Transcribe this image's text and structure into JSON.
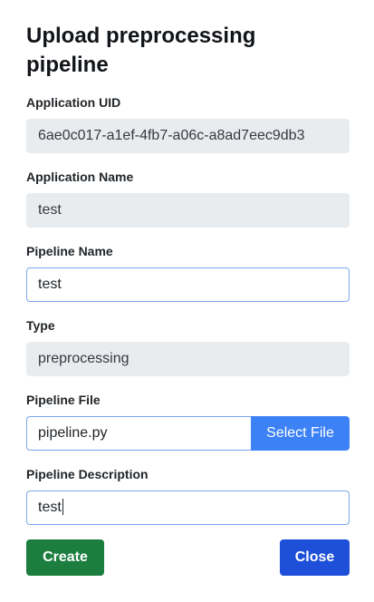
{
  "dialog": {
    "title": "Upload preprocessing pipeline"
  },
  "fields": {
    "app_uid": {
      "label": "Application UID",
      "value": "6ae0c017-a1ef-4fb7-a06c-a8ad7eec9db3"
    },
    "app_name": {
      "label": "Application Name",
      "value": "test"
    },
    "pipeline_name": {
      "label": "Pipeline Name",
      "value": "test"
    },
    "type": {
      "label": "Type",
      "value": "preprocessing"
    },
    "pipeline_file": {
      "label": "Pipeline File",
      "value": "pipeline.py",
      "button_label": "Select File"
    },
    "pipeline_description": {
      "label": "Pipeline Description",
      "value": "test"
    }
  },
  "actions": {
    "create_label": "Create",
    "close_label": "Close"
  },
  "colors": {
    "create_button": "#1b7d3e",
    "close_button": "#1d4fd8",
    "select_file_button": "#3c82f6",
    "readonly_field": "#e9ecef",
    "focus_border": "#7aa7f0"
  }
}
